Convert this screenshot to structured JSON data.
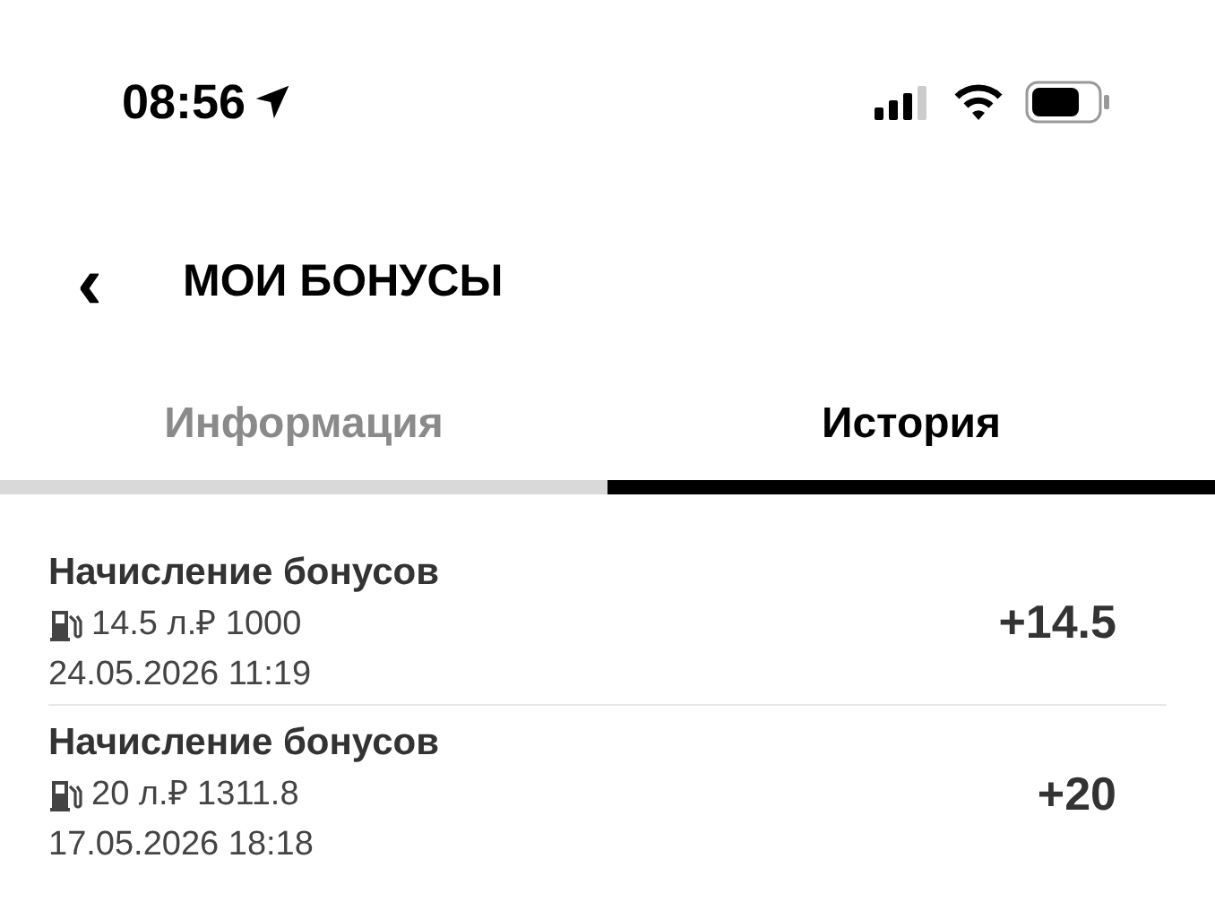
{
  "status_bar": {
    "time": "08:56"
  },
  "header": {
    "back": "‹",
    "title": "МОИ БОНУСЫ"
  },
  "tabs": [
    {
      "label": "Информация",
      "selected": false
    },
    {
      "label": "История",
      "selected": true
    }
  ],
  "transactions": [
    {
      "title": "Начисление бонусов",
      "details": "14.5 л.₽ 1000",
      "date": "24.05.2026 11:19",
      "amount": "+14.5"
    },
    {
      "title": "Начисление бонусов",
      "details": "20 л.₽ 1311.8",
      "date": "17.05.2026 18:18",
      "amount": "+20"
    }
  ]
}
